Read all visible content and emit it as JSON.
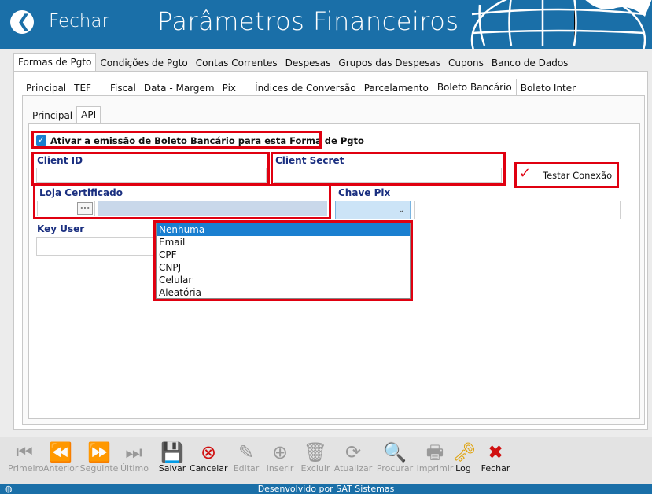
{
  "header": {
    "back_label": "Fechar",
    "title": "Parâmetros Financeiros"
  },
  "tabs_level1": [
    "Formas de Pgto",
    "Condições de Pgto",
    "Contas Correntes",
    "Despesas",
    "Grupos das Despesas",
    "Cupons",
    "Banco de Dados"
  ],
  "tabs_level2": [
    "Principal",
    "TEF",
    "Fiscal",
    "Data - Margem",
    "Pix",
    "Índices de Conversão",
    "Parcelamento",
    "Boleto Bancário",
    "Boleto Inter"
  ],
  "tabs_level3": [
    "Principal",
    "API"
  ],
  "form": {
    "activate_label": "Ativar a emissão de Boleto Bancário para esta Forma de Pgto",
    "client_id_label": "Client ID",
    "client_secret_label": "Client Secret",
    "test_button": "Testar Conexão",
    "loja_cert_label": "Loja Certificado",
    "browse_label": "···",
    "chave_pix_label": "Chave Pix",
    "key_user_label": "Key User"
  },
  "chave_pix_options": [
    "Nenhuma",
    "Email",
    "CPF",
    "CNPJ",
    "Celular",
    "Aleatória"
  ],
  "chave_pix_selected": "Nenhuma",
  "toolbar": {
    "primeiro": "Primeiro",
    "anterior": "Anterior",
    "seguinte": "Seguinte",
    "ultimo": "Último",
    "salvar": "Salvar",
    "cancelar": "Cancelar",
    "editar": "Editar",
    "inserir": "Inserir",
    "excluir": "Excluir",
    "atualizar": "Atualizar",
    "procurar": "Procurar",
    "imprimir": "Imprimir",
    "log": "Log",
    "fechar": "Fechar"
  },
  "footer": "Desenvolvido por SAT Sistemas",
  "colors": {
    "header": "#1a6fa8",
    "highlight": "#e00010",
    "selection": "#1a7fd0",
    "label": "#1a2f80"
  }
}
